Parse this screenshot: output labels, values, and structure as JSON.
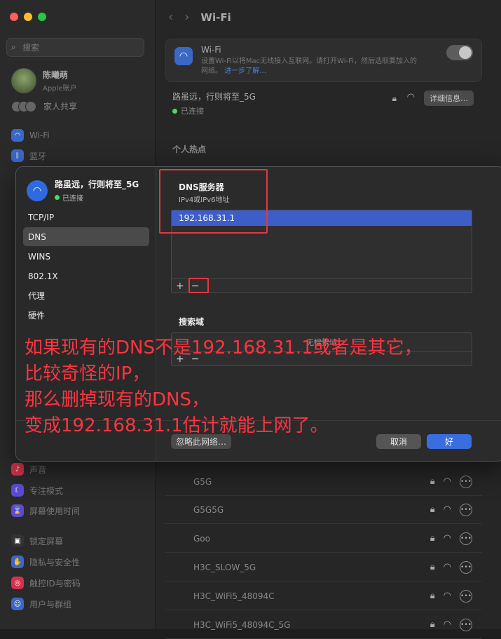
{
  "window": {
    "traffic_lights": {
      "close": "#ff5f57",
      "minimize": "#febc2e",
      "zoom": "#28c840"
    }
  },
  "sidebar": {
    "search_placeholder": "搜索",
    "profile": {
      "name": "陈曦萌",
      "subtitle": "Apple账户"
    },
    "family": "家人共享",
    "items": [
      {
        "label": "Wi-Fi",
        "icon": "wifi-icon",
        "color": "#3a68c7"
      },
      {
        "label": "蓝牙",
        "icon": "bluetooth-icon",
        "color": "#3a68c7"
      },
      {
        "label": "声音",
        "icon": "sound-icon",
        "color": "#d2334a"
      },
      {
        "label": "专注模式",
        "icon": "focus-icon",
        "color": "#5a4bd1"
      },
      {
        "label": "屏幕使用时间",
        "icon": "screen-time-icon",
        "color": "#5a4bd1"
      },
      {
        "label": "锁定屏幕",
        "icon": "lock-icon",
        "color": "#333"
      },
      {
        "label": "隐私与安全性",
        "icon": "privacy-icon",
        "color": "#3a68c7"
      },
      {
        "label": "触控ID与密码",
        "icon": "touchid-icon",
        "color": "#d2334a"
      },
      {
        "label": "用户与群组",
        "icon": "users-icon",
        "color": "#3a68c7"
      }
    ]
  },
  "main": {
    "title": "Wi-Fi",
    "wifi_card": {
      "label": "Wi-Fi",
      "desc_line1": "设置Wi-Fi以将Mac无线接入互联网。请打开Wi-Fi，然后选取要加入的",
      "desc_line2": "网络。",
      "learn_more": "进一步了解…"
    },
    "current_network": {
      "name": "路虽远，行则将至_5G",
      "status": "已连接",
      "details_button": "详细信息…"
    },
    "hotspot_header": "个人热点",
    "networks": [
      "G5G",
      "G5G5G",
      "Goo",
      "H3C_SLOW_5G",
      "H3C_WiFi5_48094C",
      "H3C_WiFi5_48094C_5G"
    ]
  },
  "dialog": {
    "network_name": "路虽远，行则将至_5G",
    "status": "已连接",
    "nav": [
      "TCP/IP",
      "DNS",
      "WINS",
      "802.1X",
      "代理",
      "硬件"
    ],
    "active_nav": "DNS",
    "dns": {
      "title": "DNS服务器",
      "subtitle": "IPv4或IPv6地址",
      "servers": [
        "192.168.31.1"
      ]
    },
    "search_domains": {
      "title": "搜索域",
      "empty": "无搜索域"
    },
    "plus": "+",
    "minus": "−",
    "ignore_button": "忽略此网络…",
    "cancel_button": "取消",
    "ok_button": "好"
  },
  "annotation": {
    "line1": "如果现有的DNS不是192.168.31.1或者是其它，",
    "line2": "比较奇怪的IP，",
    "line3": "那么删掉现有的DNS，",
    "line4": "变成192.168.31.1估计就能上网了。"
  }
}
